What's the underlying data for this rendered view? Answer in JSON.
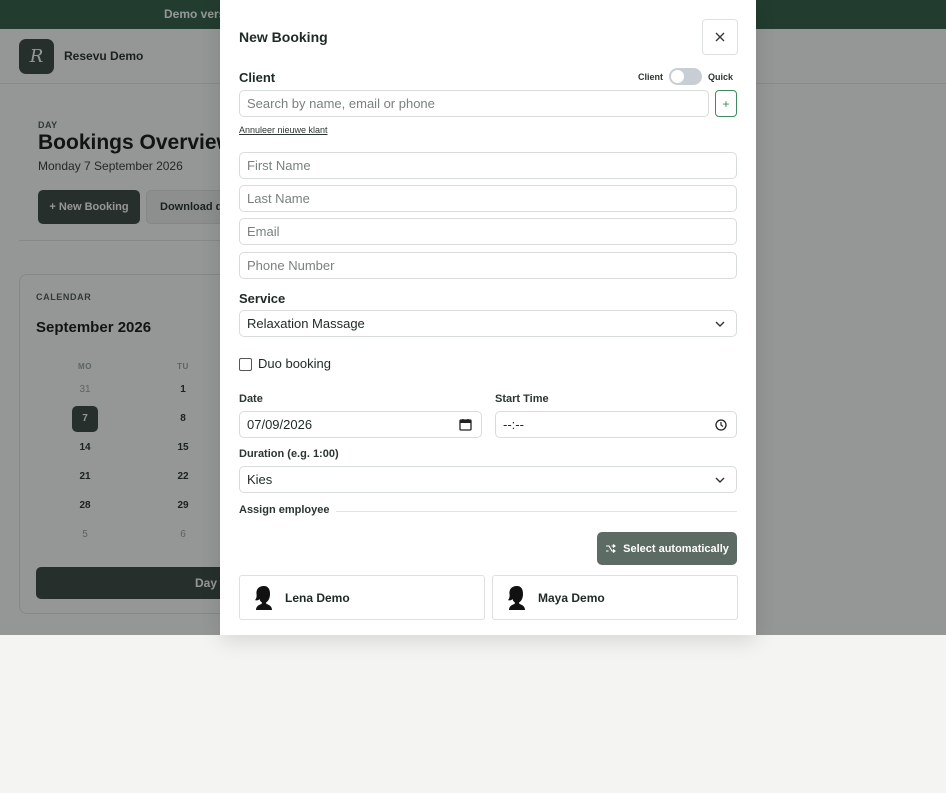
{
  "background": {
    "banner": "Demo versie",
    "brand": {
      "logo_letter": "R",
      "name": "Resevu Demo"
    },
    "page": {
      "eyebrow": "DAY",
      "title": "Bookings Overview",
      "subtitle": "Monday 7 September 2026"
    },
    "actions": {
      "new_booking": "+ New Booking",
      "download": "Download data"
    },
    "calendar": {
      "label": "CALENDAR",
      "month": "September 2026",
      "weekdays": [
        "MO",
        "TU"
      ],
      "rows": [
        [
          "31",
          "1"
        ],
        [
          "7",
          "8"
        ],
        [
          "14",
          "15"
        ],
        [
          "21",
          "22"
        ],
        [
          "28",
          "29"
        ],
        [
          "5",
          "6"
        ]
      ],
      "selected": "7",
      "view_button": "Day"
    }
  },
  "modal": {
    "title": "New Booking",
    "close_icon": "close-icon",
    "client": {
      "label": "Client",
      "toggle_left": "Client",
      "toggle_right": "Quick",
      "search_placeholder": "Search by name, email or phone",
      "add_label": "+",
      "cancel_link": "Annuleer nieuwe klant"
    },
    "new_client": {
      "first_name_placeholder": "First Name",
      "last_name_placeholder": "Last Name",
      "email_placeholder": "Email",
      "phone_placeholder": "Phone Number"
    },
    "service": {
      "label": "Service",
      "value": "Relaxation Massage"
    },
    "duo": {
      "label": "Duo booking",
      "checked": false
    },
    "date": {
      "label": "Date",
      "value": "07/09/2026"
    },
    "start_time": {
      "label": "Start Time",
      "value": "--:--"
    },
    "duration": {
      "label": "Duration (e.g. 1:00)",
      "value": "Kies"
    },
    "assign": {
      "label": "Assign employee",
      "auto_button": "Select automatically",
      "employees": [
        {
          "name": "Lena Demo"
        },
        {
          "name": "Maya Demo"
        }
      ]
    }
  },
  "colors": {
    "accent": "#2e5a44",
    "dark": "#38423e",
    "auto_button": "#5c6b63",
    "plus": "#3f8a5c"
  }
}
